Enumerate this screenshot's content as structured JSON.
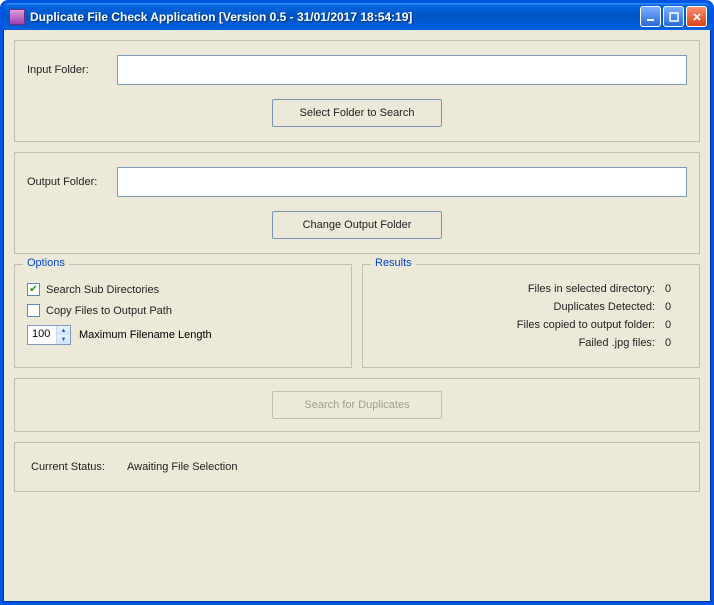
{
  "window": {
    "title": "Duplicate File Check Application [Version 0.5 - 31/01/2017 18:54:19]"
  },
  "input": {
    "label": "Input Folder:",
    "value": "",
    "button": "Select Folder to Search"
  },
  "output": {
    "label": "Output Folder:",
    "value": "",
    "button": "Change Output Folder"
  },
  "options": {
    "legend": "Options",
    "search_sub": {
      "label": "Search Sub Directories",
      "checked": true
    },
    "copy_files": {
      "label": "Copy Files to Output Path",
      "checked": false
    },
    "max_filename": {
      "label": "Maximum Filename Length",
      "value": "100"
    }
  },
  "results": {
    "legend": "Results",
    "rows": [
      {
        "k": "Files in selected directory:",
        "v": "0"
      },
      {
        "k": "Duplicates Detected:",
        "v": "0"
      },
      {
        "k": "Files copied to output folder:",
        "v": "0"
      },
      {
        "k": "Failed .jpg files:",
        "v": "0"
      }
    ]
  },
  "search_button": "Search for Duplicates",
  "status": {
    "label": "Current Status:",
    "value": "Awaiting File Selection"
  }
}
